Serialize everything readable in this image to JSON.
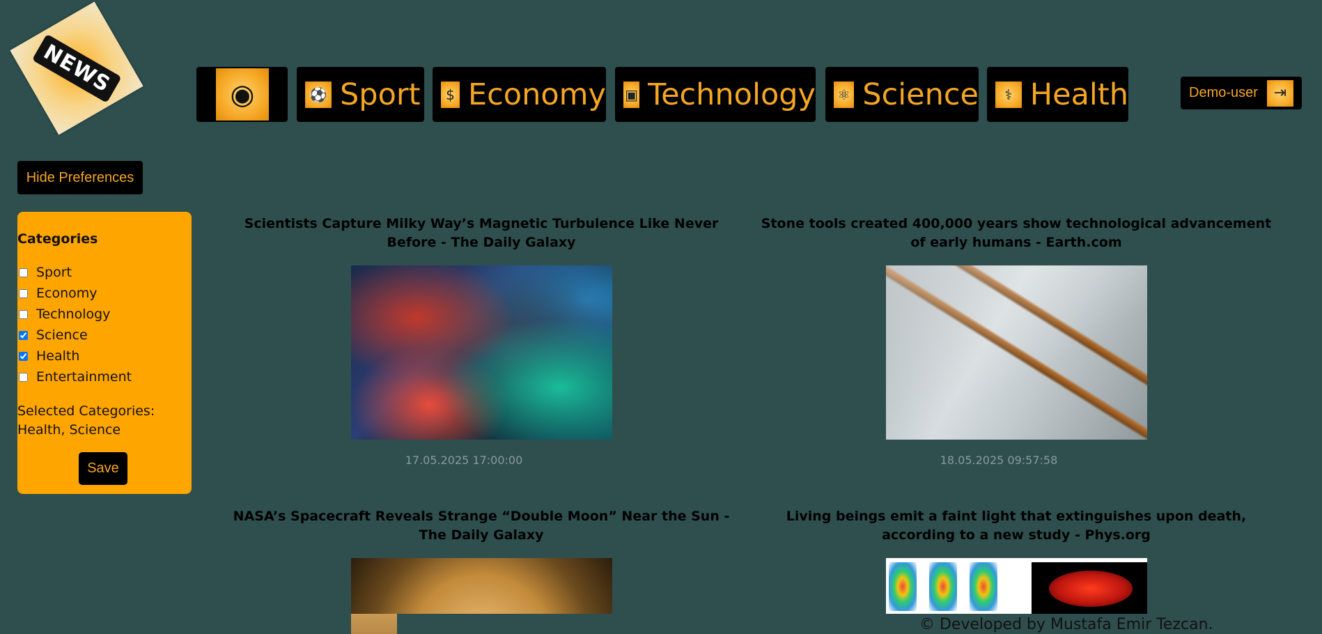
{
  "logo": {
    "text": "NEWS"
  },
  "nav": {
    "home_icon": "headline-icon",
    "items": [
      {
        "label": "Sport",
        "icon": "soccer-ball-icon",
        "glyph": "⚽"
      },
      {
        "label": "Economy",
        "icon": "dollar-icon",
        "glyph": "$"
      },
      {
        "label": "Technology",
        "icon": "chip-icon",
        "glyph": "▣"
      },
      {
        "label": "Science",
        "icon": "atom-icon",
        "glyph": "⚛"
      },
      {
        "label": "Health",
        "icon": "stethoscope-icon",
        "glyph": "⚕"
      }
    ]
  },
  "user": {
    "label": "Demo-user",
    "icon": "login-icon"
  },
  "preferences": {
    "toggle_label": "Hide Preferences",
    "title": "Categories",
    "categories": [
      {
        "label": "Sport",
        "checked": false
      },
      {
        "label": "Economy",
        "checked": false
      },
      {
        "label": "Technology",
        "checked": false
      },
      {
        "label": "Science",
        "checked": true
      },
      {
        "label": "Health",
        "checked": true
      },
      {
        "label": "Entertainment",
        "checked": false
      }
    ],
    "selected_label": "Selected Categories:",
    "selected_values": "Health, Science",
    "save_label": "Save"
  },
  "articles": [
    {
      "title": "Scientists Capture Milky Way’s Magnetic Turbulence Like Never Before - The Daily Galaxy",
      "date": "17.05.2025 17:00:00"
    },
    {
      "title": "Stone tools created 400,000 years show technological advancement of early humans - Earth.com",
      "date": "18.05.2025 09:57:58"
    },
    {
      "title": "NASA’s Spacecraft Reveals Strange “Double Moon” Near the Sun - The Daily Galaxy",
      "date": ""
    },
    {
      "title": "Living beings emit a faint light that extinguishes upon death, according to a new study - Phys.org",
      "date": ""
    }
  ],
  "footer": {
    "text": "© Developed by Mustafa Emir Tezcan."
  },
  "colors": {
    "background": "#2f4f4f",
    "accent": "#ffa500",
    "button": "#000000",
    "text_accent": "#f5a623"
  }
}
